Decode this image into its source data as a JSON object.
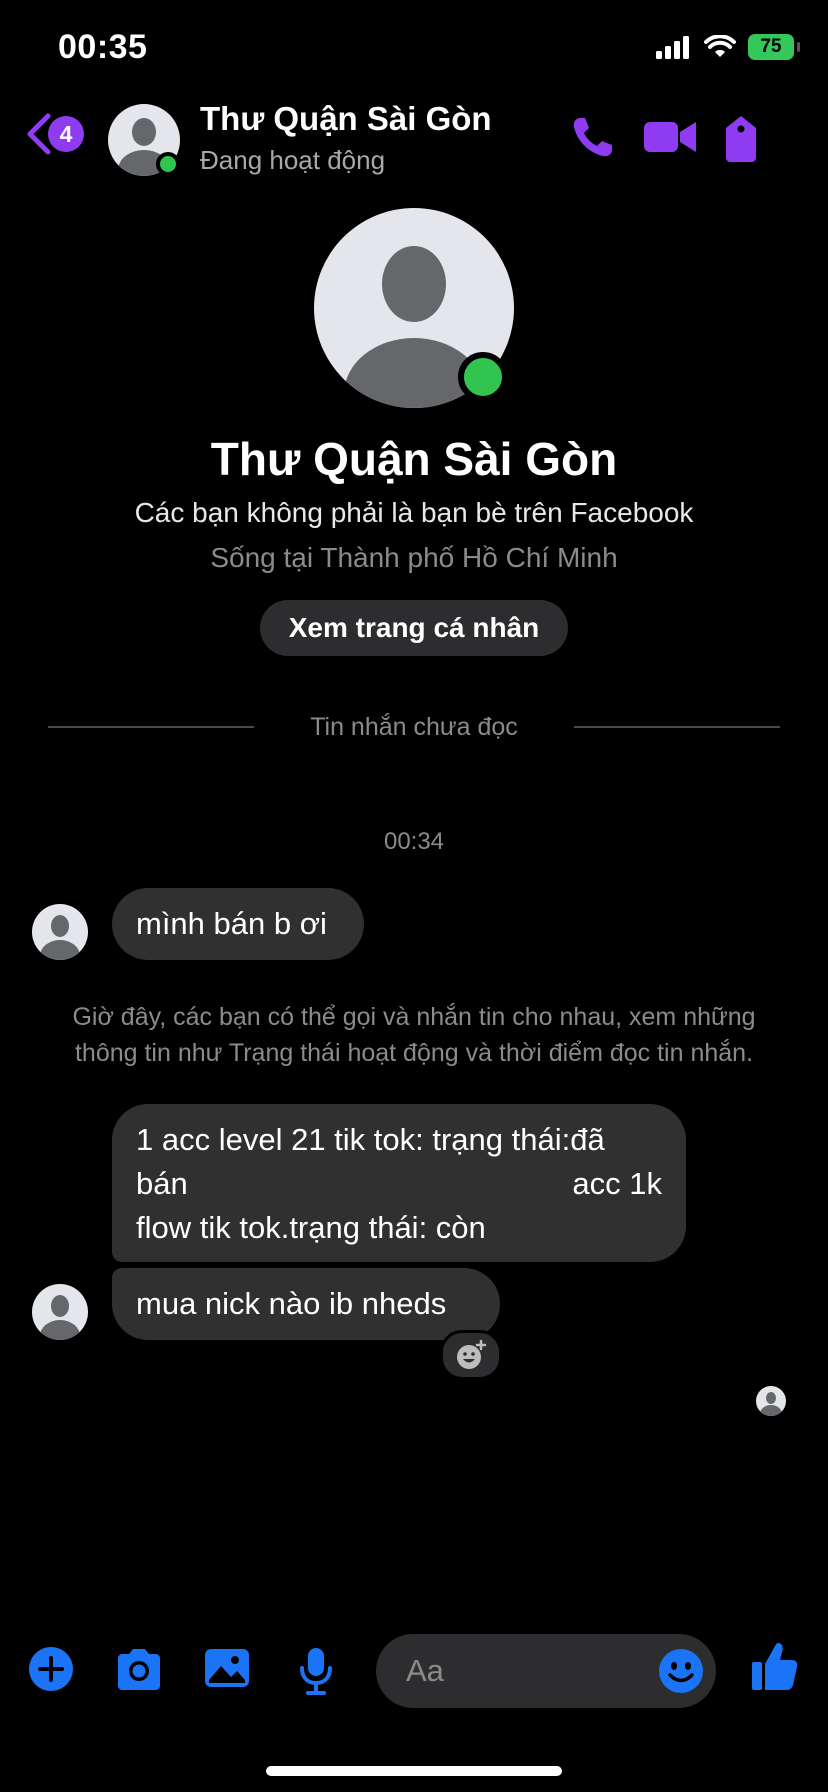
{
  "status_bar": {
    "time": "00:35",
    "battery": "75"
  },
  "header": {
    "back_badge": "4",
    "contact_name": "Thư Quận Sài Gòn",
    "activity_status": "Đang hoạt động"
  },
  "profile": {
    "name": "Thư Quận Sài Gòn",
    "friend_status": "Các bạn không phải là bạn bè trên Facebook",
    "location": "Sống tại Thành phố Hồ Chí Minh",
    "view_profile_label": "Xem trang cá nhân"
  },
  "unread_divider": "Tin nhắn chưa đọc",
  "timestamp": "00:34",
  "messages": [
    {
      "text": "mình bán b ơi"
    },
    {
      "lines": [
        "1 acc level 21 tik tok: trạng thái:đã",
        "bán",
        "acc 1k",
        "flow tik tok.trạng thái: còn"
      ]
    },
    {
      "text": "mua nick nào ib nheds"
    }
  ],
  "system_note": {
    "line1": "Giờ đây, các bạn có thể gọi và nhắn tin cho nhau, xem những",
    "line2": "thông tin như Trạng thái hoạt động và thời điểm đọc tin nhắn."
  },
  "composer": {
    "placeholder": "Aa"
  },
  "colors": {
    "accent_purple": "#8f3bf2",
    "accent_blue": "#1b74f5",
    "online_green": "#31c44f",
    "bubble": "#303030"
  },
  "icons": [
    "back-chevron-icon",
    "phone-icon",
    "video-camera-icon",
    "tag-icon",
    "plus-icon",
    "camera-icon",
    "image-icon",
    "microphone-icon",
    "emoji-icon",
    "thumbs-up-icon",
    "add-reaction-icon"
  ]
}
